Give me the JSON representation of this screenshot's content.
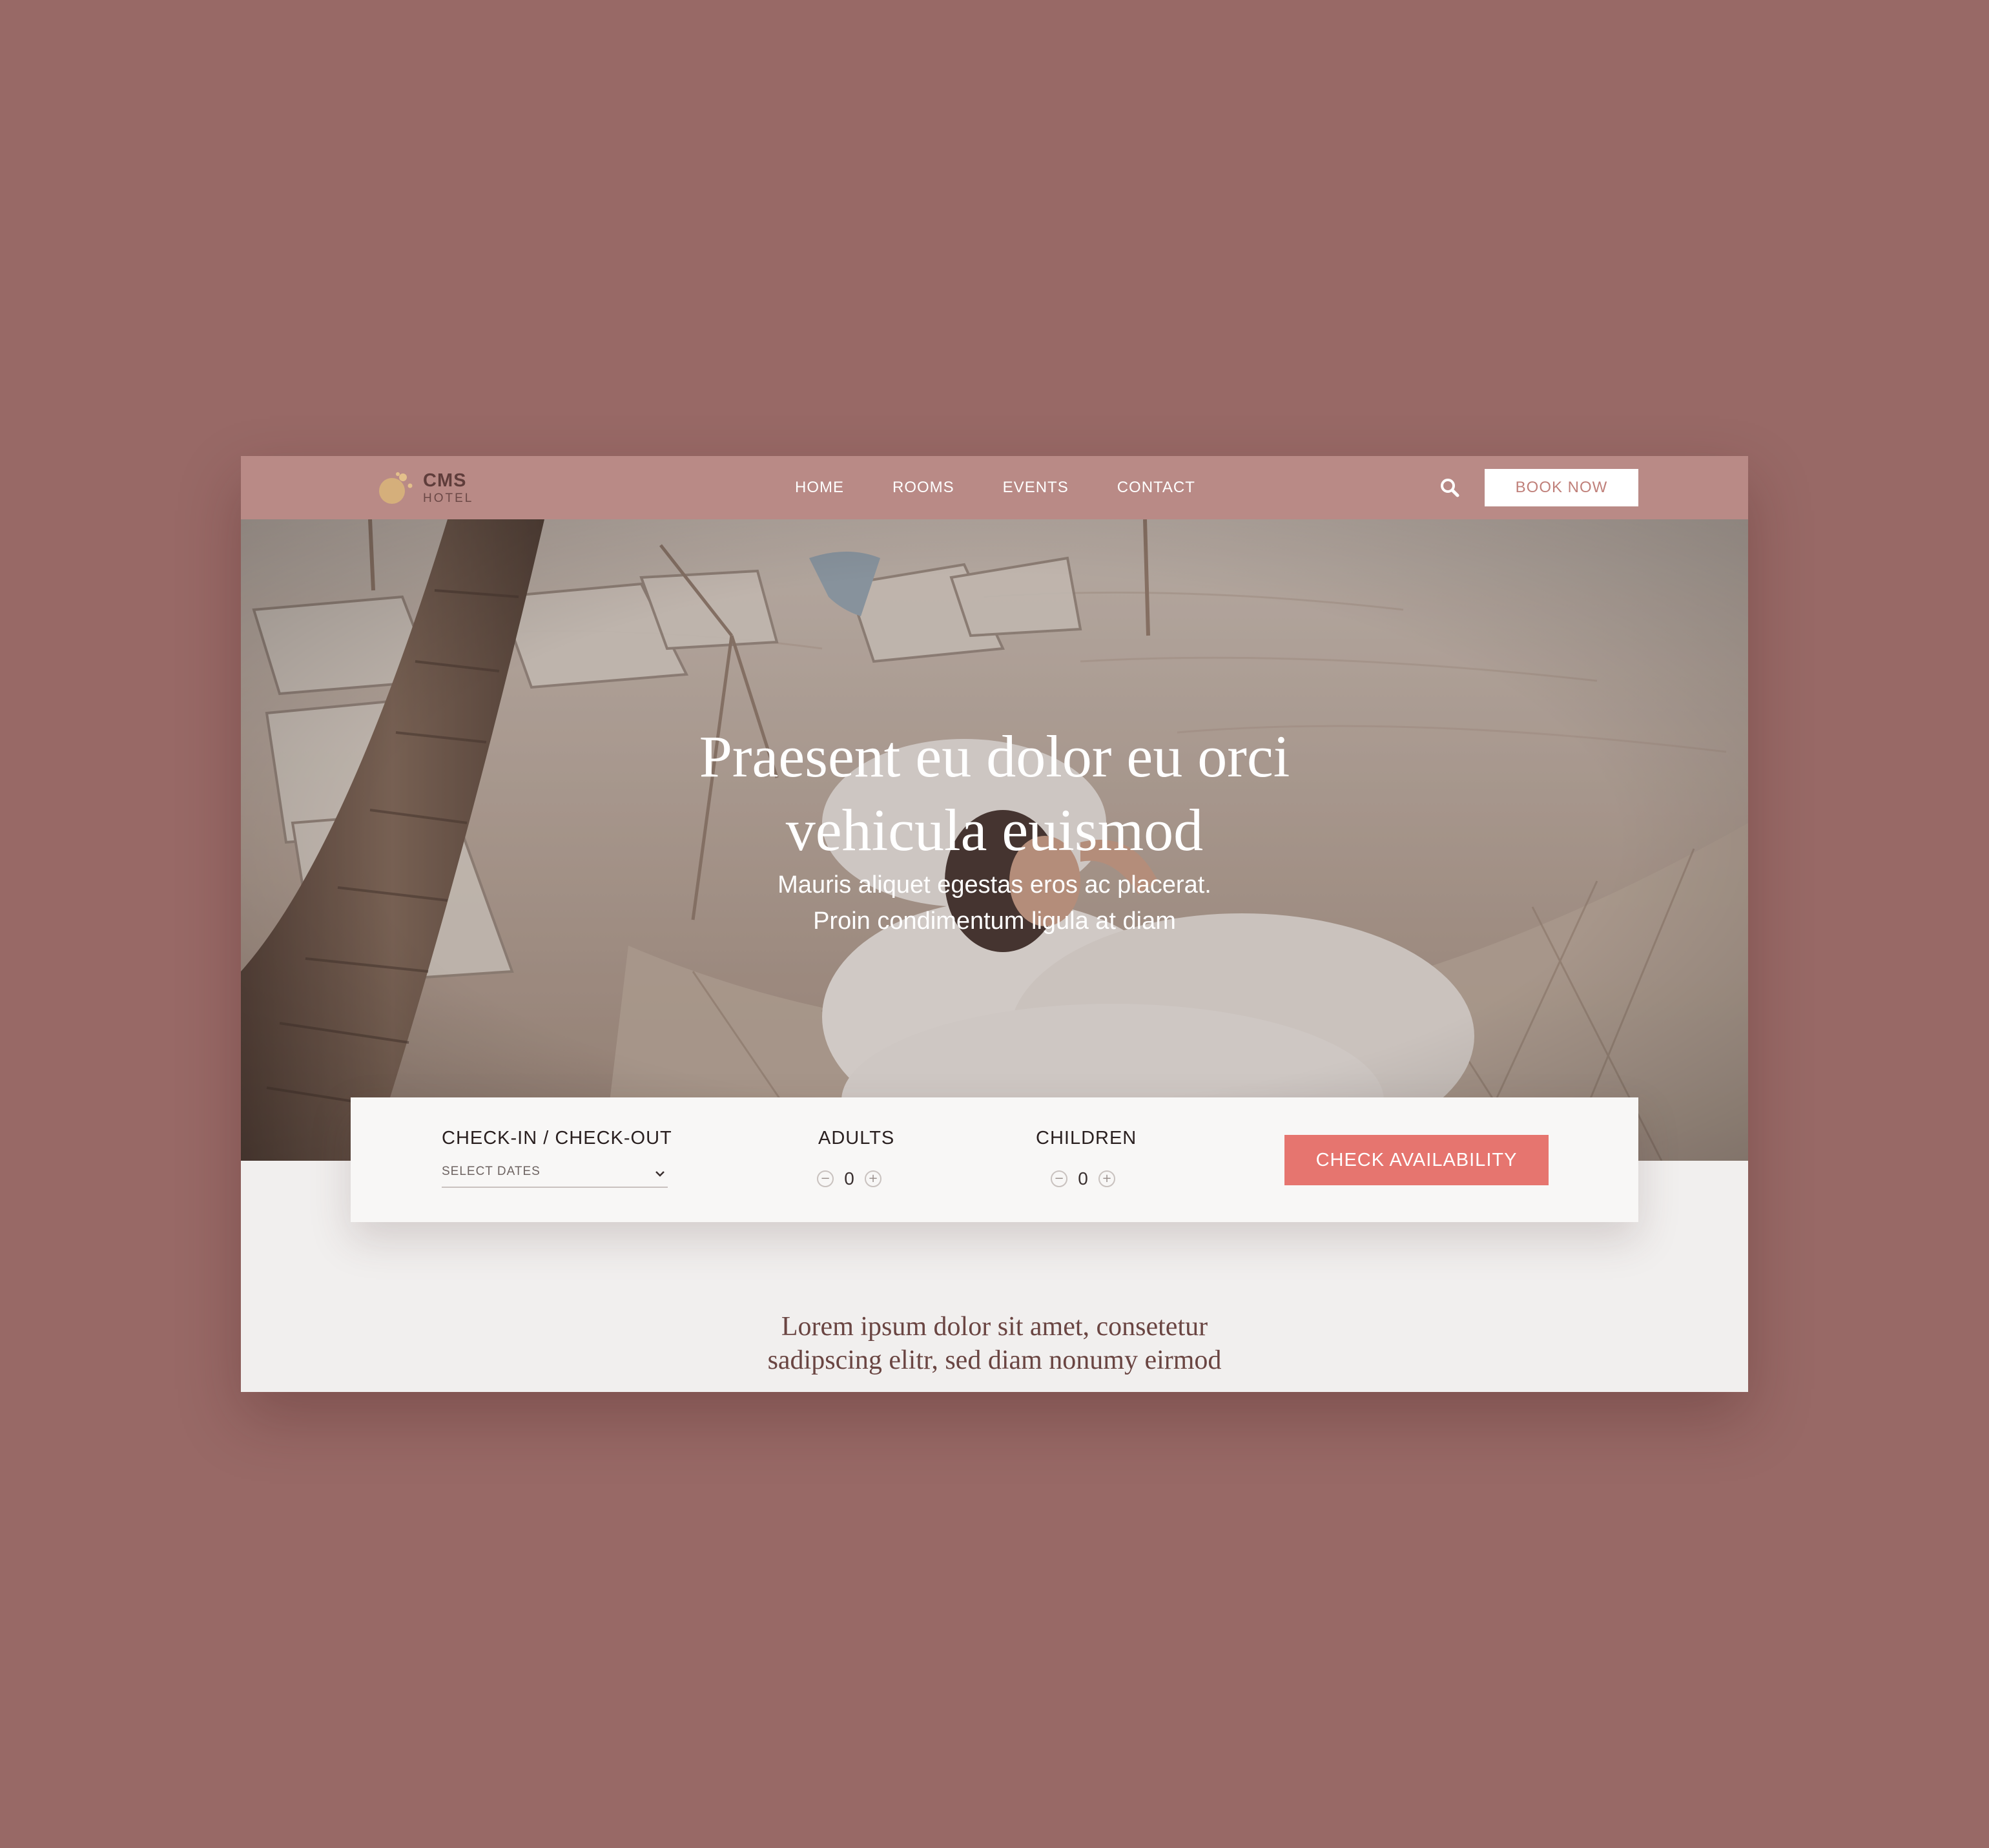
{
  "brand": {
    "name": "CMS",
    "subtitle": "HOTEL"
  },
  "nav": {
    "items": [
      {
        "label": "HOME"
      },
      {
        "label": "ROOMS"
      },
      {
        "label": "EVENTS"
      },
      {
        "label": "CONTACT"
      }
    ],
    "search_icon": "search-icon",
    "book_label": "BOOK NOW"
  },
  "hero": {
    "title_line1": "Praesent eu dolor eu orci",
    "title_line2": "vehicula euismod",
    "subtitle_line1": "Mauris aliquet egestas eros ac placerat.",
    "subtitle_line2": "Proin condimentum ligula at diam"
  },
  "booking": {
    "dates_label": "CHECK-IN / CHECK-OUT",
    "dates_placeholder": "SELECT DATES",
    "dates_icon": "chevron-down-icon",
    "adults_label": "ADULTS",
    "adults_value": "0",
    "children_label": "CHILDREN",
    "children_value": "0",
    "minus_glyph": "−",
    "plus_glyph": "+",
    "check_label": "CHECK AVAILABILITY"
  },
  "intro": {
    "line1": "Lorem ipsum dolor sit amet, consetetur",
    "line2": "sadipscing elitr, sed diam nonumy eirmod"
  },
  "colors": {
    "page_background": "#986966",
    "nav_background": "#b98a86",
    "accent": "#e6756f",
    "book_text": "#c0807a",
    "logo_gold": "#d8b27a"
  }
}
